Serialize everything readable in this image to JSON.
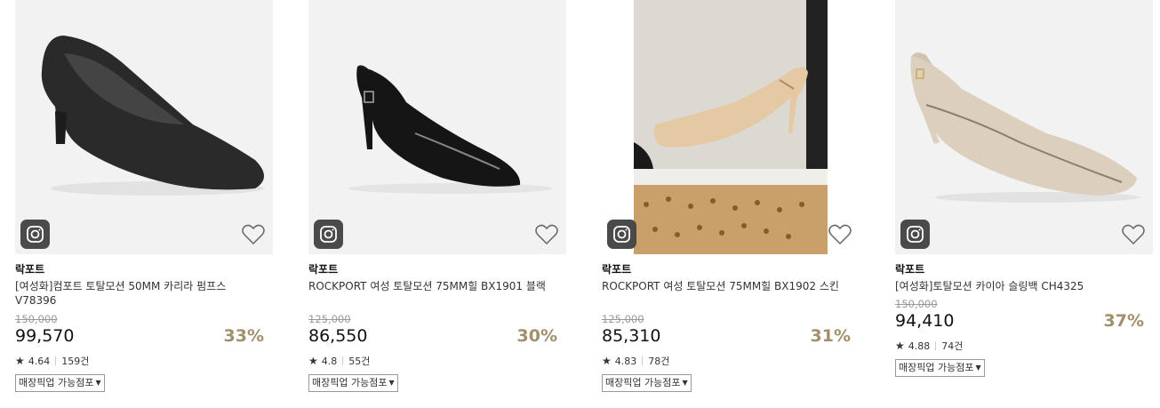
{
  "products": [
    {
      "brand": "락포트",
      "name": "[여성화]컴포트 토탈모션 50MM 카리라 펌프스 V78396",
      "original_price": "150,000",
      "price": "99,570",
      "discount": "33%",
      "rating": "4.64",
      "reviews": "159건",
      "pickup_label": "매장픽업 가능점포"
    },
    {
      "brand": "락포트",
      "name": "ROCKPORT 여성 토탈모션 75MM힐 BX1901 블랙",
      "original_price": "125,000",
      "price": "86,550",
      "discount": "30%",
      "rating": "4.8",
      "reviews": "55건",
      "pickup_label": "매장픽업 가능점포"
    },
    {
      "brand": "락포트",
      "name": "ROCKPORT 여성 토탈모션 75MM힐 BX1902 스킨",
      "original_price": "125,000",
      "price": "85,310",
      "discount": "31%",
      "rating": "4.83",
      "reviews": "78건",
      "pickup_label": "매장픽업 가능점포"
    },
    {
      "brand": "락포트",
      "name": "[여성화]토탈모션 카이아 슬링백 CH4325",
      "original_price": "150,000",
      "price": "94,410",
      "discount": "37%",
      "rating": "4.88",
      "reviews": "74건",
      "pickup_label": "매장픽업 가능점포"
    }
  ],
  "icons": {
    "insta": "instagram-icon",
    "wish": "heart-icon",
    "star": "star-icon",
    "dropdown": "triangle-down-icon"
  },
  "colors": {
    "discount": "#a28f6b",
    "badge_bg": "#4a4a4a"
  }
}
